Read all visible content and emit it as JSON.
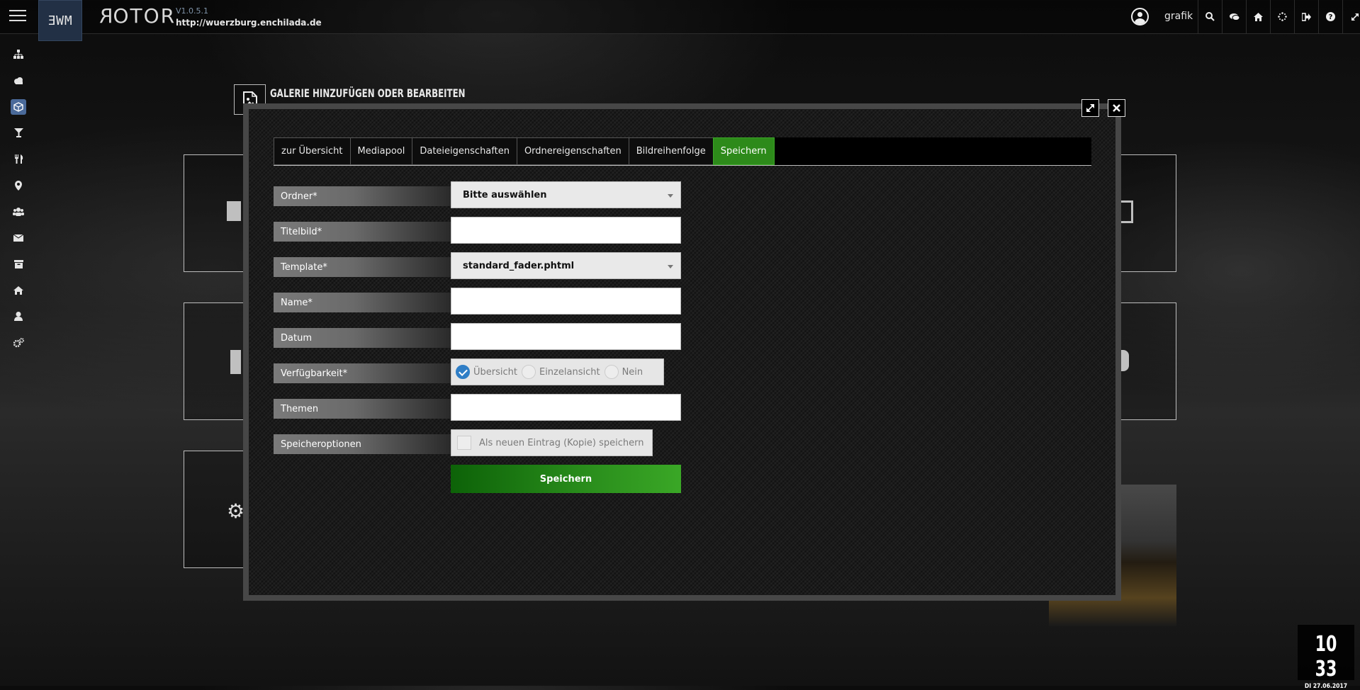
{
  "app": {
    "brand": "ƎWM",
    "logo": "ROTOR",
    "version": "V1.0.5.1",
    "url": "http://wuerzburg.enchilada.de"
  },
  "topbar": {
    "username": "grafik",
    "icons": [
      "search-icon",
      "chat-icon",
      "home-icon",
      "spinner-icon",
      "logout-icon",
      "help-icon",
      "fullscreen-icon"
    ]
  },
  "sidebar": {
    "items": [
      "sitemap-icon",
      "cloud-icon",
      "cube-icon",
      "cocktail-icon",
      "restaurant-icon",
      "map-marker-icon",
      "users-icon",
      "envelope-icon",
      "archive-icon",
      "home-icon",
      "user-icon",
      "cogs-icon"
    ],
    "active_index": 2
  },
  "modal": {
    "title": "GALERIE HINZUFÜGEN ODER BEARBEITEN",
    "tabs": [
      {
        "label": "zur Übersicht",
        "active": false
      },
      {
        "label": "Mediapool",
        "active": false
      },
      {
        "label": "Dateieigenschaften",
        "active": false
      },
      {
        "label": "Ordnereigenschaften",
        "active": false
      },
      {
        "label": "Bildreihenfolge",
        "active": false
      },
      {
        "label": "Speichern",
        "active": true
      }
    ],
    "form": {
      "ordner": {
        "label": "Ordner*",
        "value": "Bitte auswählen"
      },
      "titelbild": {
        "label": "Titelbild*",
        "value": ""
      },
      "template": {
        "label": "Template*",
        "value": "standard_fader.phtml"
      },
      "name": {
        "label": "Name*",
        "value": ""
      },
      "datum": {
        "label": "Datum",
        "value": ""
      },
      "verfuegbarkeit": {
        "label": "Verfügbarkeit*",
        "options": [
          "Übersicht",
          "Einzelansicht",
          "Nein"
        ],
        "selected": "Übersicht"
      },
      "themen": {
        "label": "Themen",
        "value": ""
      },
      "speicheroptionen": {
        "label": "Speicheroptionen",
        "checkbox_label": "Als neuen Eintrag (Kopie) speichern",
        "checked": false
      }
    },
    "save_button": "Speichern"
  },
  "clock": {
    "time": "10 33",
    "date": "DI 27.06.2017"
  }
}
